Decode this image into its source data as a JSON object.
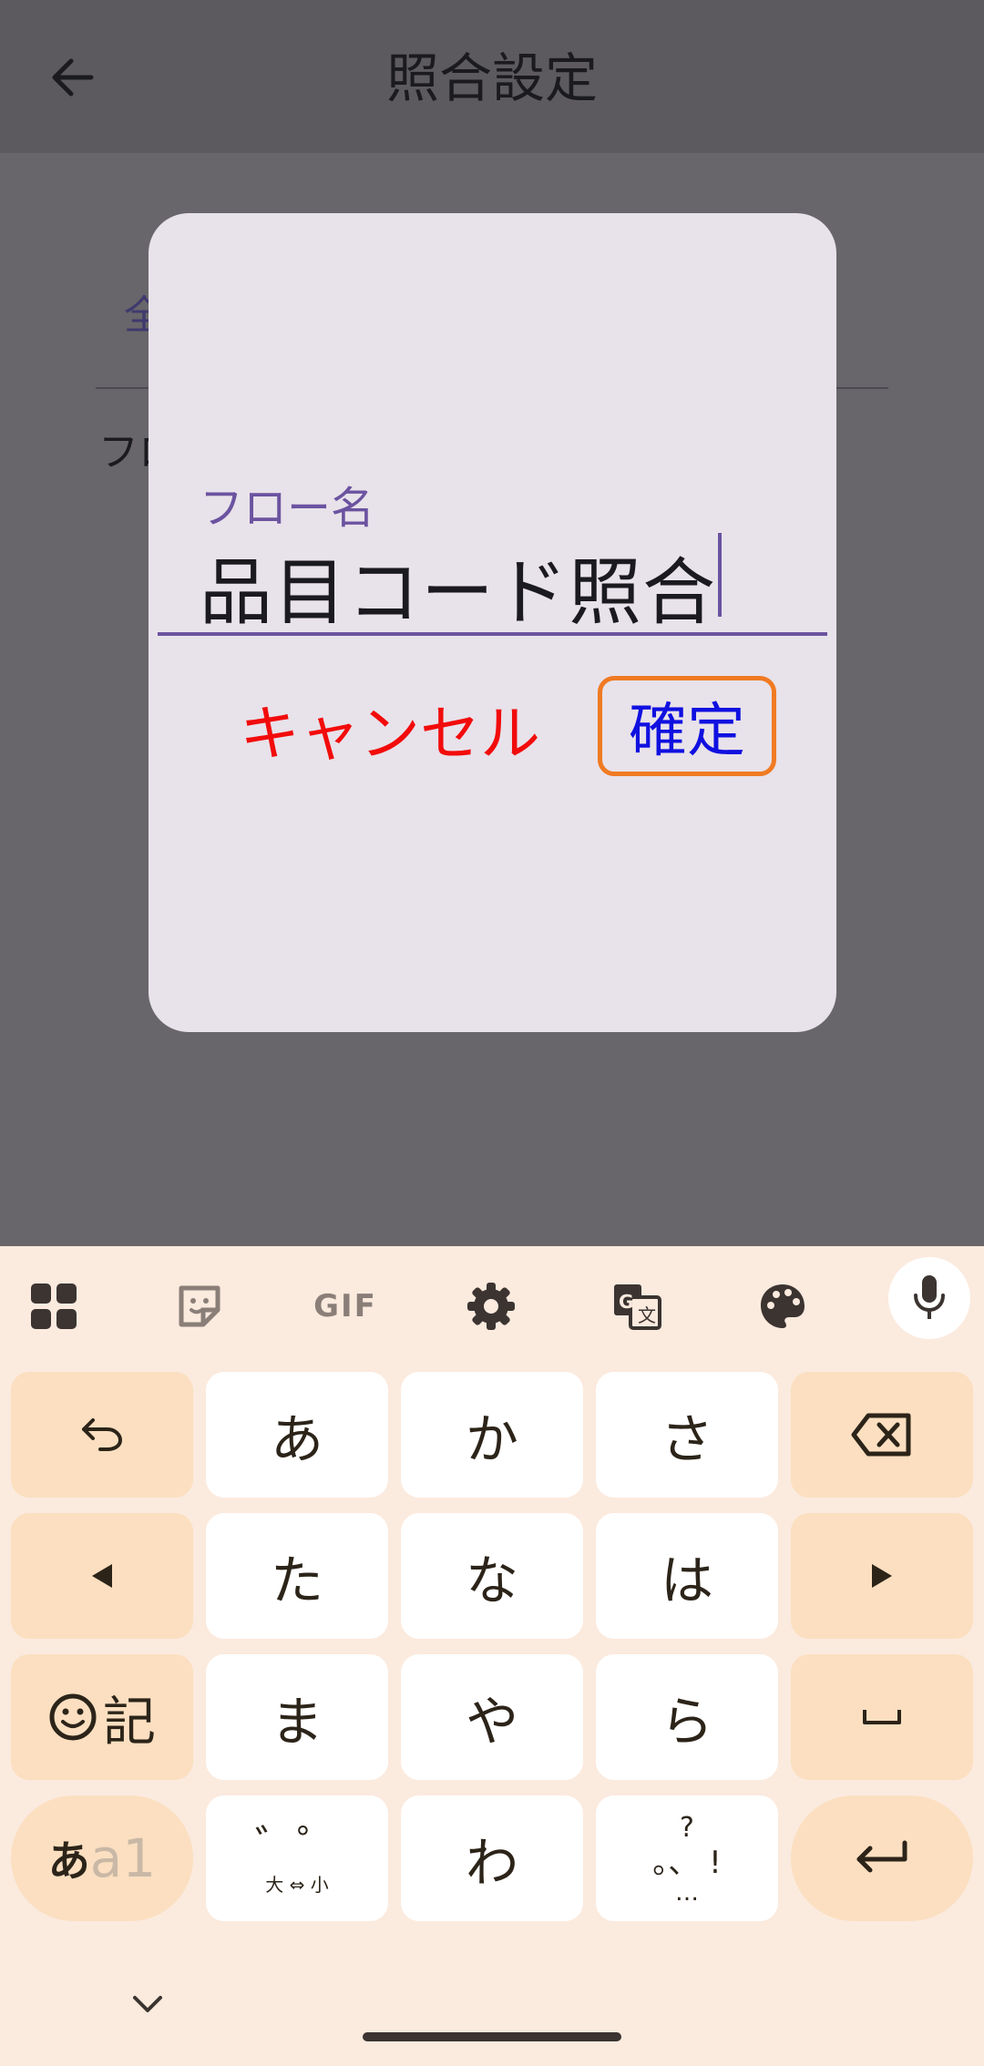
{
  "appbar": {
    "title": "照合設定"
  },
  "background": {
    "tab_fragment": "全",
    "flow_fragment": "フロ"
  },
  "dialog": {
    "field_label": "フロー名",
    "field_value": "品目コード照合",
    "cancel_label": "キャンセル",
    "confirm_label": "確定"
  },
  "keyboard": {
    "toolbar": [
      "apps-grid-icon",
      "sticker-icon",
      "GIF",
      "gear-icon",
      "translate-icon",
      "palette-icon",
      "mic-icon"
    ],
    "gif_label": "GIF",
    "row1": {
      "k1": "あ",
      "k2": "か",
      "k3": "さ"
    },
    "row2": {
      "k1": "た",
      "k2": "な",
      "k3": "は"
    },
    "row3": {
      "k1": "ま",
      "k2": "や",
      "k3": "ら",
      "emoji_label": "記"
    },
    "row4": {
      "mode_kana": "あ",
      "mode_alpha": "a1",
      "dakuten_top": "゛゜",
      "dakuten_bottom": "大 ⇔ 小",
      "k2": "わ",
      "punct_top": "?",
      "punct_mid": "。、 !",
      "punct_bottom": "…"
    }
  }
}
